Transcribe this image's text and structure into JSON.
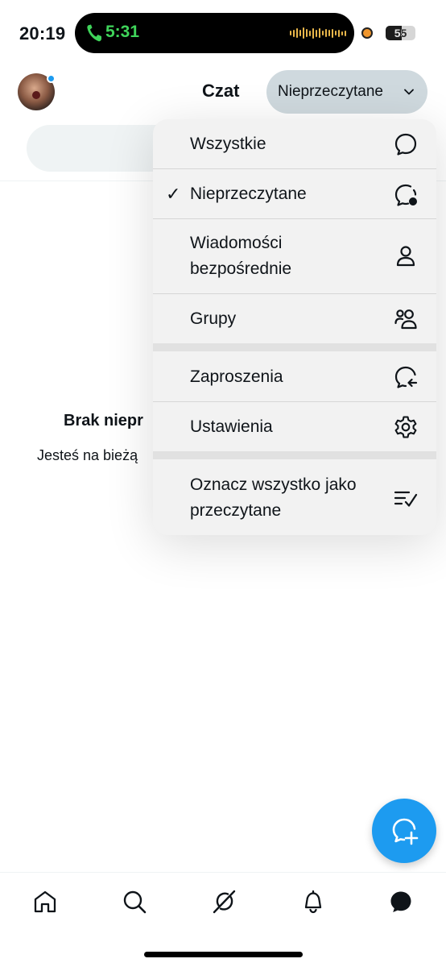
{
  "status_bar": {
    "time": "20:19",
    "call_time": "5:31",
    "battery_level": "55",
    "battery_fraction": 0.55,
    "call_color": "#3fd45a"
  },
  "header": {
    "title": "Czat",
    "filter_label": "Nieprzeczytane"
  },
  "empty_state": {
    "title": "Brak niepr",
    "subtitle": "Jesteś na bieżą"
  },
  "menu": {
    "items": [
      {
        "label": "Wszystkie",
        "icon": "chat-bubble-icon",
        "checked": false
      },
      {
        "label": "Nieprzeczytane",
        "icon": "chat-bubble-unread-icon",
        "checked": true,
        "check_mark": "✓"
      },
      {
        "label_line1": "Wiadomości",
        "label_line2": "bezpośrednie",
        "icon": "person-icon",
        "checked": false
      },
      {
        "label": "Grupy",
        "icon": "people-icon",
        "checked": false
      },
      {
        "label": "Zaproszenia",
        "icon": "chat-bubble-arrow-icon",
        "checked": false
      },
      {
        "label": "Ustawienia",
        "icon": "gear-icon",
        "checked": false
      },
      {
        "label_line1": "Oznacz wszystko jako",
        "label_line2": "przeczytane",
        "icon": "mark-read-icon",
        "checked": false
      }
    ]
  },
  "fab": {
    "icon": "new-chat-icon",
    "color": "#1d9bf0"
  },
  "bottom_nav": {
    "items": [
      {
        "icon": "home-icon"
      },
      {
        "icon": "search-icon"
      },
      {
        "icon": "grok-icon"
      },
      {
        "icon": "bell-icon"
      },
      {
        "icon": "chat-icon",
        "active": true
      }
    ]
  }
}
